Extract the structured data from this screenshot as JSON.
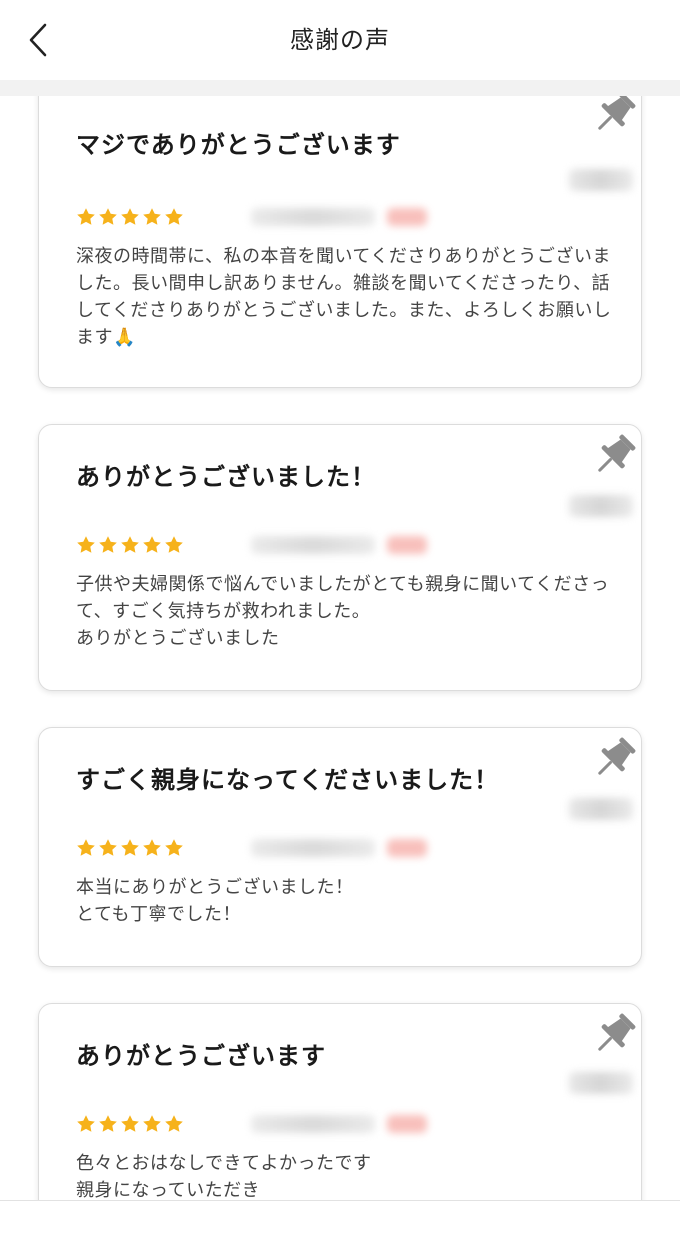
{
  "header": {
    "title": "感謝の声",
    "back_icon": "chevron-left-icon"
  },
  "reviews": [
    {
      "title": "マジでありがとうございます",
      "rating": 5,
      "body": "深夜の時間帯に、私の本音を聞いてくださりありがとうございました。長い間申し訳ありません。雑談を聞いてくださったり、話してくださりありがとうございました。また、よろしくお願いします🙏"
    },
    {
      "title": "ありがとうございました！",
      "rating": 5,
      "body": "子供や夫婦関係で悩んでいましたがとても親身に聞いてくださって、すごく気持ちが救われました。\nありがとうございました"
    },
    {
      "title": "すごく親身になってくださいました！",
      "rating": 5,
      "body": "本当にありがとうございました！\nとても丁寧でした！"
    },
    {
      "title": "ありがとうございます",
      "rating": 5,
      "body": "色々とおはなしできてよかったです\n親身になっていただき"
    }
  ],
  "colors": {
    "star": "#f6b21b",
    "pin": "#8c8c8c",
    "divider": "#f2f2f2"
  }
}
